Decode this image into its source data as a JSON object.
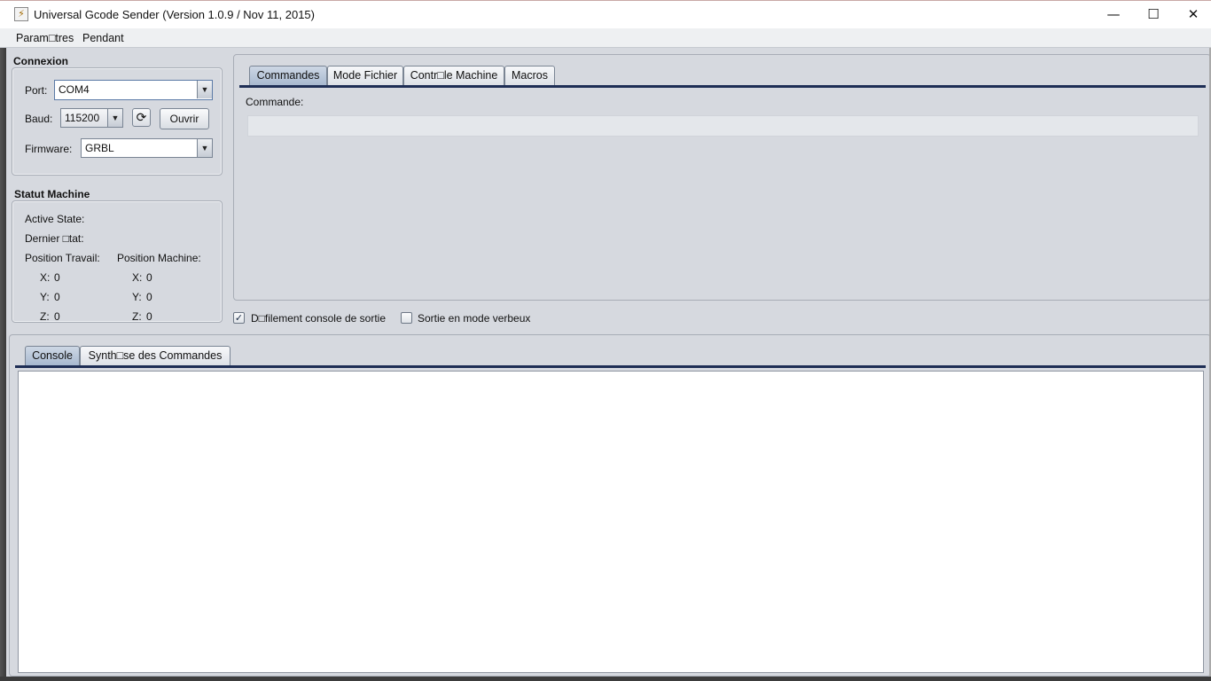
{
  "window": {
    "title": "Universal Gcode Sender (Version 1.0.9 / Nov 11, 2015)",
    "minimize": "—",
    "maximize": "☐",
    "close": "✕"
  },
  "menu": {
    "items": [
      "Param□tres",
      "Pendant"
    ]
  },
  "connection": {
    "title": "Connexion",
    "port_label": "Port:",
    "port_value": "COM4",
    "baud_label": "Baud:",
    "baud_value": "115200",
    "open_label": "Ouvrir",
    "firmware_label": "Firmware:",
    "firmware_value": "GRBL"
  },
  "machine_status": {
    "title": "Statut Machine",
    "active_state_label": "Active State:",
    "last_state_label": "Dernier □tat:",
    "work_position_label": "Position Travail:",
    "machine_position_label": "Position Machine:",
    "work": {
      "x_label": "X:",
      "x": "0",
      "y_label": "Y:",
      "y": "0",
      "z_label": "Z:",
      "z": "0"
    },
    "machine": {
      "x_label": "X:",
      "x": "0",
      "y_label": "Y:",
      "y": "0",
      "z_label": "Z:",
      "z": "0"
    }
  },
  "top_tabs": [
    "Commandes",
    "Mode Fichier",
    "Contr□le Machine",
    "Macros"
  ],
  "commands": {
    "label": "Commande:",
    "value": ""
  },
  "options": {
    "scroll_label": "D□filement console de sortie",
    "scroll_checked": "✓",
    "verbose_label": "Sortie en mode verbeux",
    "verbose_checked": ""
  },
  "bottom_tabs": [
    "Console",
    "Synth□se des Commandes"
  ],
  "icons": {
    "app": "app-icon",
    "refresh": "⟳",
    "dropdown": "▼"
  }
}
